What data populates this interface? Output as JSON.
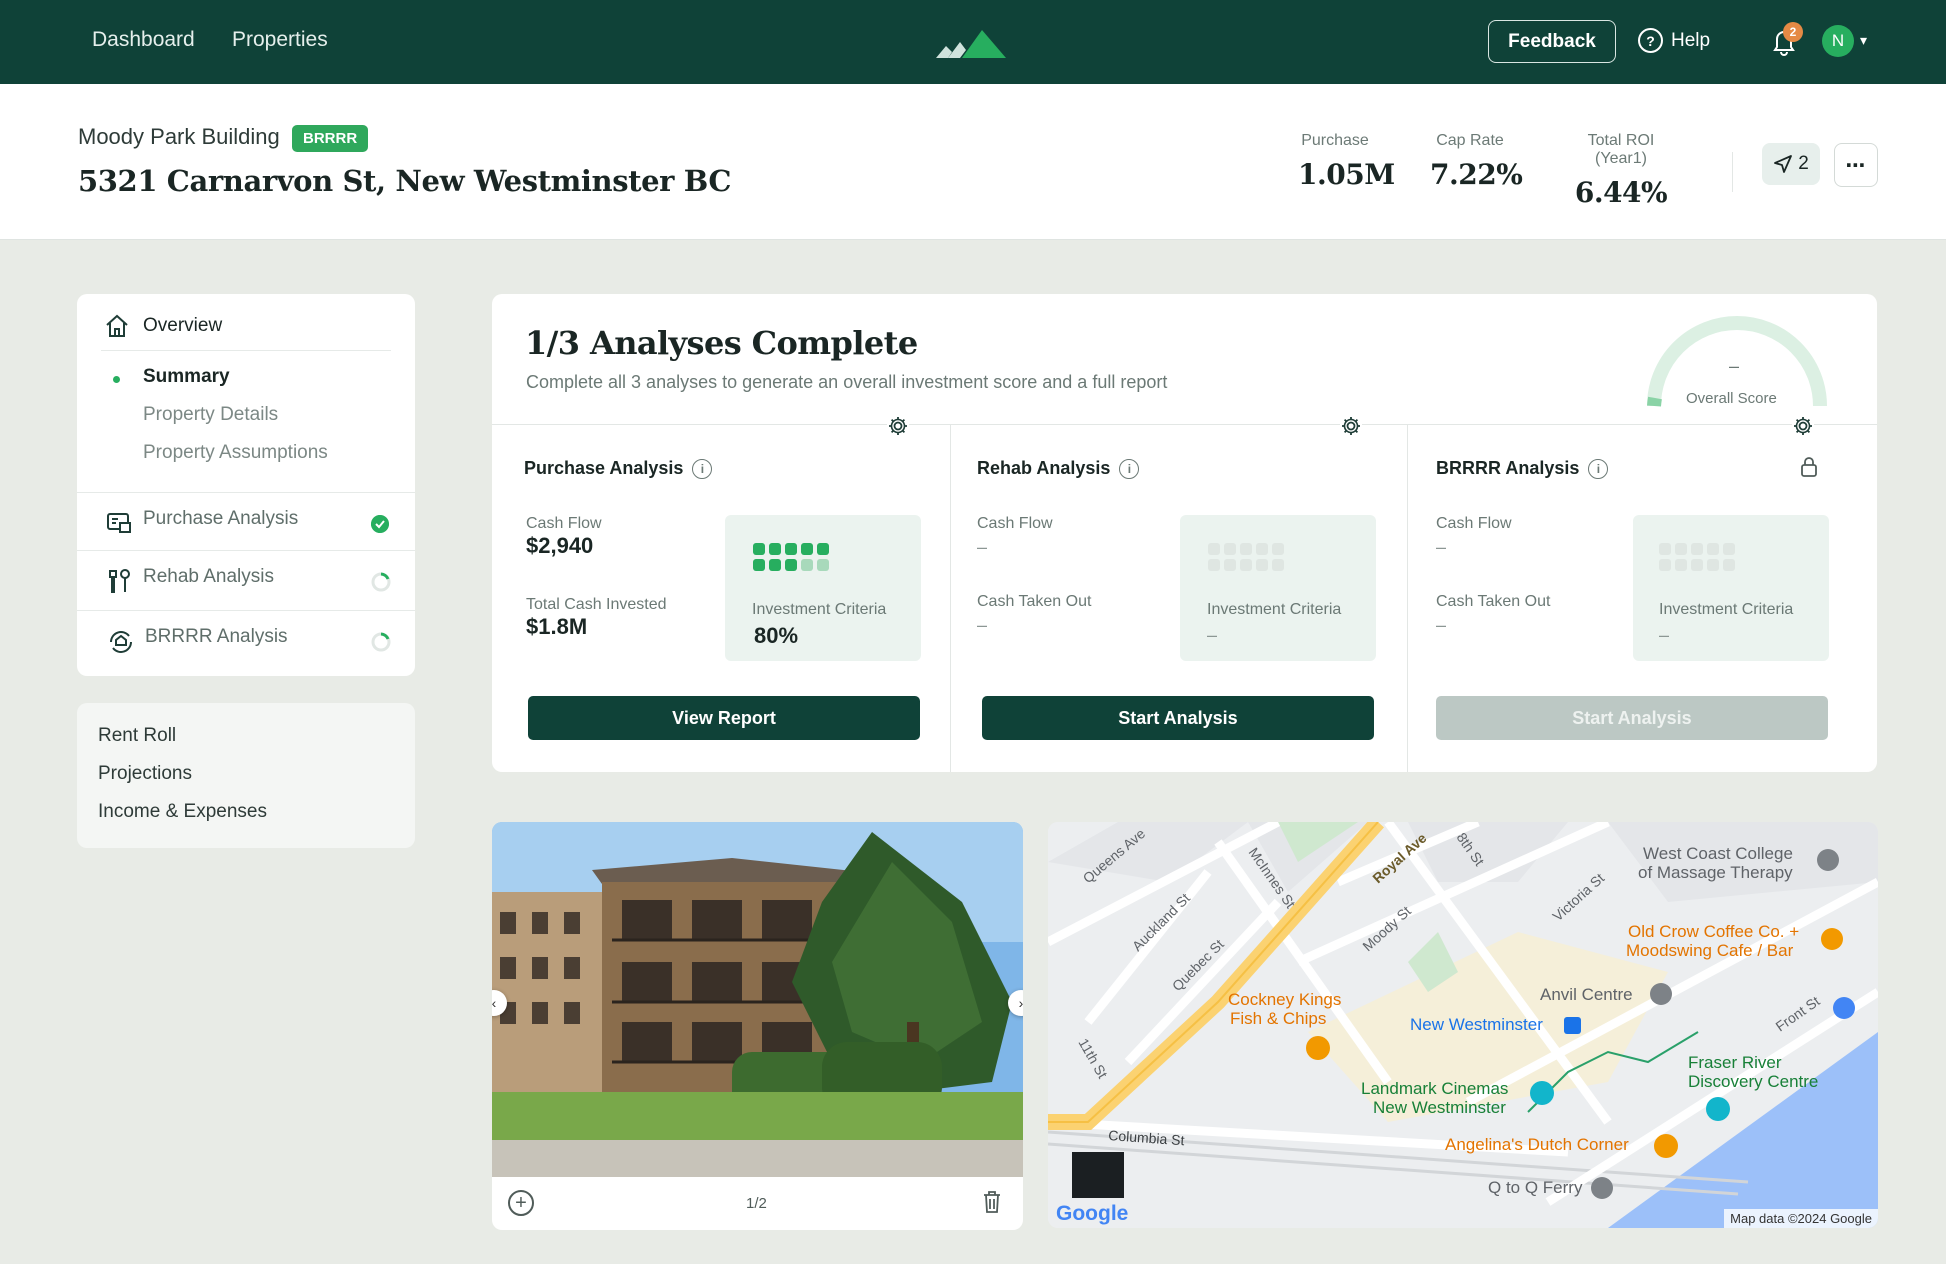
{
  "topbar": {
    "nav": [
      "Dashboard",
      "Properties"
    ],
    "feedback": "Feedback",
    "help": "Help",
    "notifications": "2",
    "avatar": "N"
  },
  "property": {
    "name": "Moody Park Building",
    "badge": "BRRRR",
    "address": "5321 Carnarvon St, New Westminster BC",
    "metrics": [
      {
        "label": "Purchase",
        "value": "1.05M"
      },
      {
        "label": "Cap Rate",
        "value": "7.22%"
      },
      {
        "label": "Total ROI (Year1)",
        "value": "6.44%"
      }
    ],
    "share_count": "2"
  },
  "sidebar": {
    "overview": "Overview",
    "sub_items": [
      "Summary",
      "Property Details",
      "Property Assumptions"
    ],
    "analyses": [
      {
        "label": "Purchase Analysis",
        "status": "complete"
      },
      {
        "label": "Rehab Analysis",
        "status": "in-progress"
      },
      {
        "label": "BRRRR Analysis",
        "status": "in-progress"
      }
    ],
    "extra": [
      "Rent Roll",
      "Projections",
      "Income & Expenses"
    ]
  },
  "analyses": {
    "title": "1/3 Analyses Complete",
    "subtitle": "Complete all 3 analyses to generate an overall investment score and a full report",
    "overall_score_value": "–",
    "overall_score_label": "Overall Score",
    "columns": [
      {
        "title": "Purchase Analysis",
        "k1_label": "Cash Flow",
        "k1_value": "$2,940",
        "k2_label": "Total Cash Invested",
        "k2_value": "$1.8M",
        "criteria_label": "Investment Criteria",
        "criteria_value": "80%",
        "button": "View Report"
      },
      {
        "title": "Rehab Analysis",
        "k1_label": "Cash Flow",
        "k1_value": "–",
        "k2_label": "Cash Taken Out",
        "k2_value": "–",
        "criteria_label": "Investment Criteria",
        "criteria_value": "–",
        "button": "Start Analysis"
      },
      {
        "title": "BRRRR Analysis",
        "k1_label": "Cash Flow",
        "k1_value": "–",
        "k2_label": "Cash Taken Out",
        "k2_value": "–",
        "criteria_label": "Investment Criteria",
        "criteria_value": "–",
        "button": "Start Analysis"
      }
    ]
  },
  "photos": {
    "counter": "1/2"
  },
  "map": {
    "labels": {
      "queens": "Queens Ave",
      "royal": "Royal Ave",
      "eighth": "8th St",
      "mcinnes": "McInnes St",
      "auckland": "Auckland St",
      "quebec": "Quebec St",
      "moody": "Moody St",
      "victoria": "Victoria St",
      "eleventh": "11th St",
      "columbia": "Columbia St",
      "front": "Front St",
      "wcc1": "West Coast College",
      "wcc2": "of Massage Therapy",
      "oldcrow1": "Old Crow Coffee Co. +",
      "oldcrow2": "Moodswing Cafe / Bar",
      "anvil": "Anvil Centre",
      "cockney1": "Cockney Kings",
      "cockney2": "Fish & Chips",
      "newwest": "New Westminster",
      "fraser1": "Fraser River",
      "fraser2": "Discovery Centre",
      "landmark1": "Landmark Cinemas",
      "landmark2": "New Westminster",
      "angelina": "Angelina's Dutch Corner",
      "qtoq": "Q to Q Ferry",
      "google": "Google"
    },
    "credit": "Map data ©2024 Google"
  }
}
